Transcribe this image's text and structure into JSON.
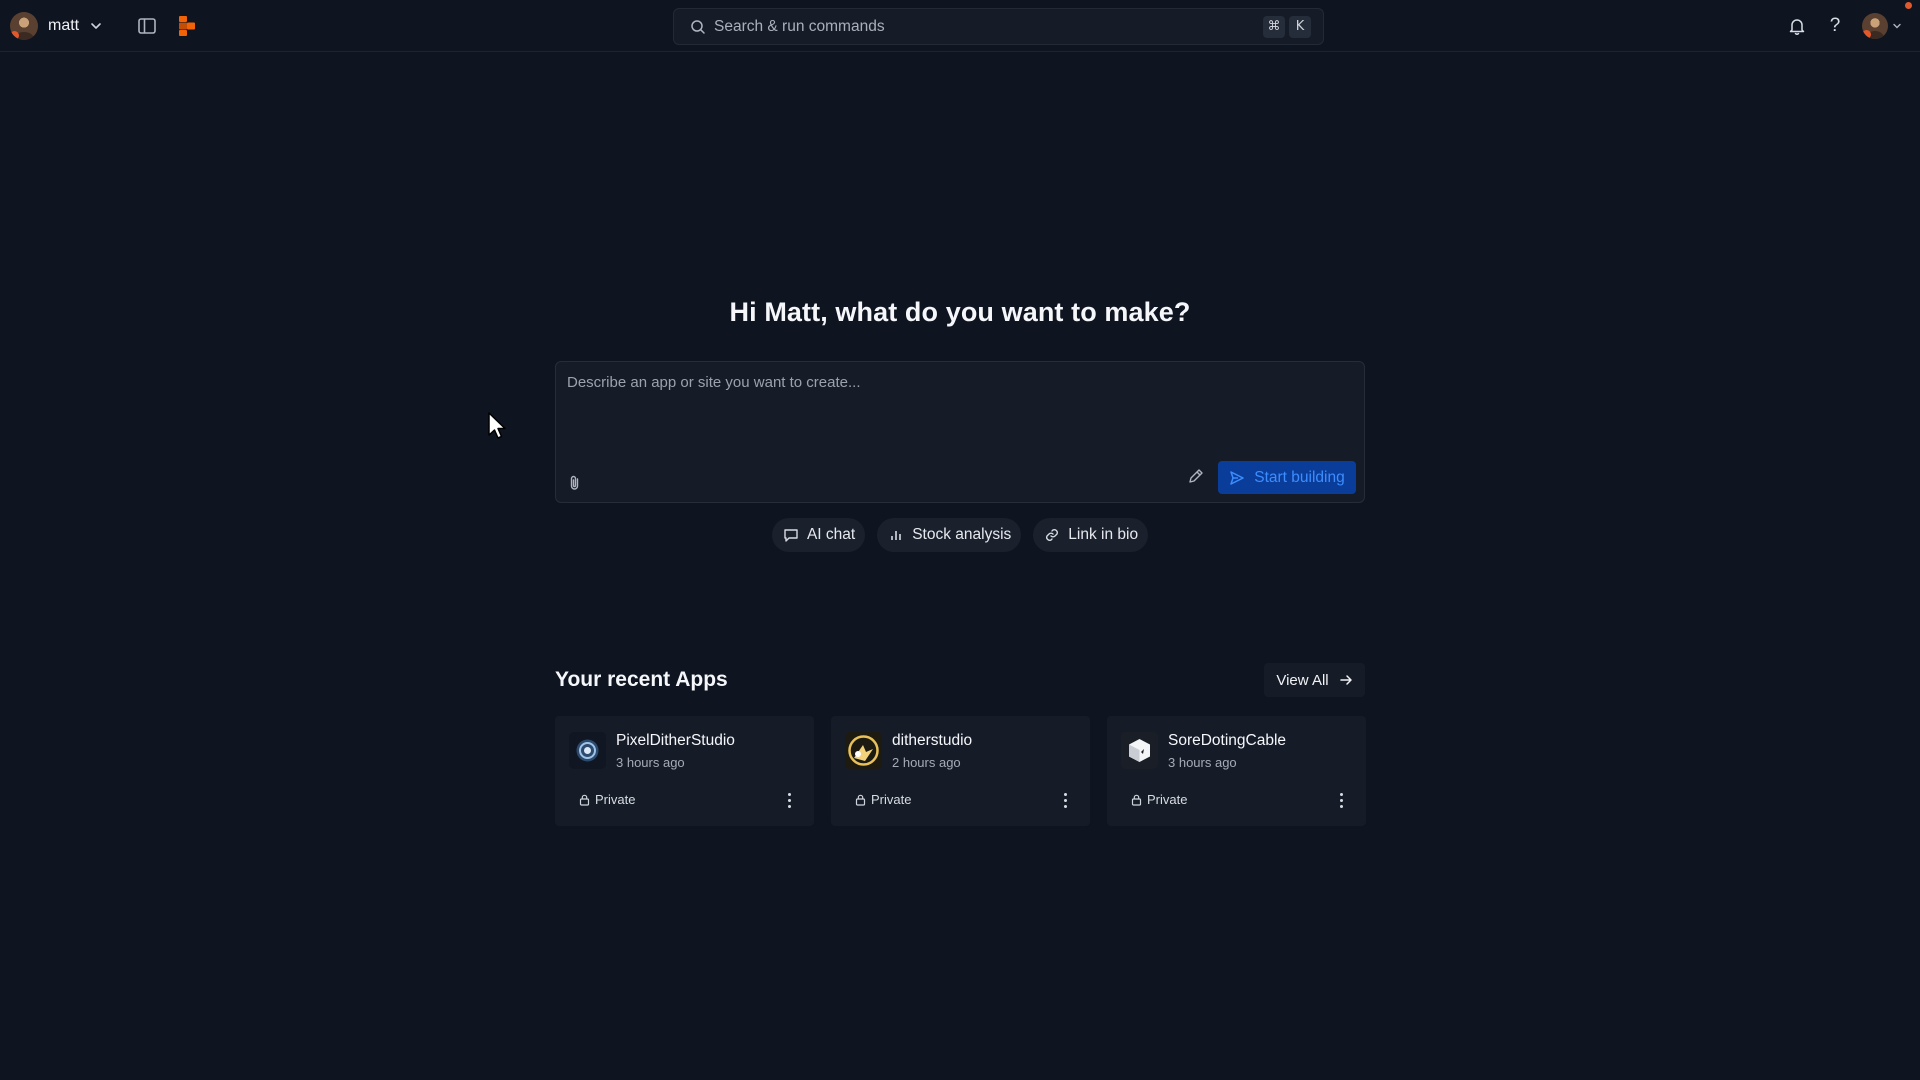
{
  "topbar": {
    "workspace_name": "matt",
    "search_placeholder": "Search & run commands",
    "shortcut_keys": [
      "⌘",
      "K"
    ],
    "help_label": "?",
    "accent_color": "#e2582b"
  },
  "hero": {
    "title": "Hi Matt, what do you want to make?",
    "prompt_placeholder": "Describe an app or site you want to create...",
    "start_button_label": "Start building",
    "chips": [
      {
        "label": "AI chat",
        "icon": "message-icon"
      },
      {
        "label": "Stock analysis",
        "icon": "bar-chart-icon"
      },
      {
        "label": "Link in bio",
        "icon": "link-icon"
      }
    ]
  },
  "recent": {
    "title": "Your recent Apps",
    "view_all_label": "View All",
    "apps": [
      {
        "name": "PixelDitherStudio",
        "updated": "3 hours ago",
        "visibility": "Private",
        "icon": "pixel-dither-app-icon"
      },
      {
        "name": "ditherstudio",
        "updated": "2 hours ago",
        "visibility": "Private",
        "icon": "ditherstudio-app-icon"
      },
      {
        "name": "SoreDotingCable",
        "updated": "3 hours ago",
        "visibility": "Private",
        "icon": "sore-doting-cable-app-icon"
      }
    ]
  }
}
